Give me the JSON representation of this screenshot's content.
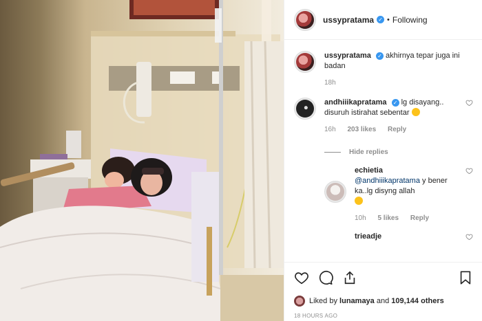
{
  "header": {
    "username": "ussypratama",
    "verified_mark": "✓",
    "separator": "•",
    "follow_status": "Following"
  },
  "caption": {
    "username": "ussypratama",
    "text": "akhirnya tepar juga ini badan",
    "age": "18h"
  },
  "comments": [
    {
      "username": "andhiiikapratama",
      "text": "lg disayang.. disuruh istirahat sebentar",
      "age": "16h",
      "likes": "203 likes",
      "reply": "Reply"
    }
  ],
  "hide_replies": "Hide replies",
  "replies": [
    {
      "username": "echietia",
      "mention": "@andhiiikapratama",
      "text": "y bener ka..lg disyng allah",
      "age": "10h",
      "likes": "5 likes",
      "reply": "Reply"
    },
    {
      "username": "trieadje"
    }
  ],
  "footer": {
    "liked_prefix": "Liked by",
    "liked_user": "lunamaya",
    "liked_and": "and",
    "liked_count": "109,144 others",
    "timestamp": "18 HOURS AGO"
  },
  "icons": [
    "heart-icon",
    "comment-icon",
    "share-icon",
    "bookmark-icon"
  ],
  "colors": {
    "verified": "#3897f0",
    "muted": "#8e8e8e",
    "text": "#262626",
    "border": "#efefef"
  }
}
